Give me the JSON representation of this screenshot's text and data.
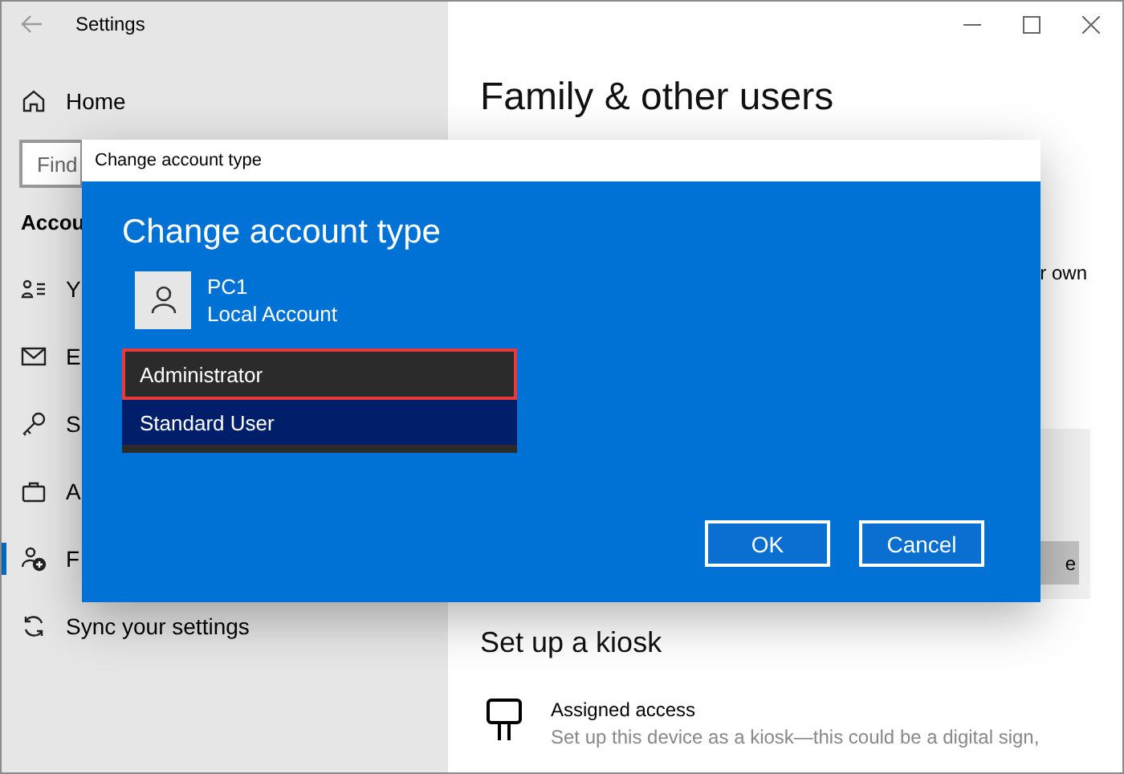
{
  "window": {
    "title": "Settings"
  },
  "sidebar": {
    "home": "Home",
    "search": {
      "placeholder": "Find"
    },
    "section": "Accou",
    "items": [
      {
        "kind": "info",
        "label": "Y",
        "selected": false
      },
      {
        "kind": "email",
        "label": "E",
        "selected": false
      },
      {
        "kind": "signin",
        "label": "S",
        "selected": false
      },
      {
        "kind": "work",
        "label": "A",
        "selected": false
      },
      {
        "kind": "family",
        "label": "F",
        "selected": true
      },
      {
        "kind": "sync",
        "label": "Sync your settings",
        "selected": false
      }
    ]
  },
  "content": {
    "title": "Family & other users",
    "text_fragment": "r own",
    "button_fragment": "e",
    "kiosk": {
      "title": "Set up a kiosk",
      "item_title": "Assigned access",
      "item_description": "Set up this device as a kiosk—this could be a digital sign,"
    }
  },
  "dialog": {
    "title": "Change account type",
    "heading": "Change account type",
    "account": {
      "name": "PC1",
      "type": "Local Account"
    },
    "options": [
      {
        "label": "Administrator",
        "selected": false,
        "hovered": true,
        "outlined": true
      },
      {
        "label": "Standard User",
        "selected": true,
        "hovered": false,
        "outlined": false
      }
    ],
    "buttons": [
      "OK",
      "Cancel"
    ]
  }
}
